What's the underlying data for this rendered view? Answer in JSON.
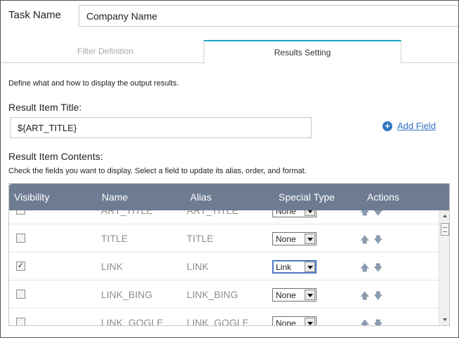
{
  "task": {
    "label": "Task Name",
    "value": "Company Name"
  },
  "tabs": [
    {
      "label": "Filter Definition",
      "active": false
    },
    {
      "label": "Results Setting",
      "active": true
    }
  ],
  "description": "Define what and how to display the output results.",
  "result_item_title": {
    "label": "Result Item Title:",
    "value": "${ART_TITLE}"
  },
  "add_field": {
    "icon": "plus-circle-icon",
    "label": "Add Field"
  },
  "result_item_contents": {
    "label": "Result Item Contents:",
    "help": "Check the fields you want to display. Select a field to update its alias, order, and format."
  },
  "grid": {
    "columns": [
      "Visibility",
      "Name",
      "Alias",
      "Special Type",
      "Actions"
    ],
    "rows": [
      {
        "checked": false,
        "name": "ART_TITLE",
        "alias": "ART_TITLE",
        "special": "None"
      },
      {
        "checked": false,
        "name": "TITLE",
        "alias": "TITLE",
        "special": "None"
      },
      {
        "checked": true,
        "name": "LINK",
        "alias": "LINK",
        "special": "Link"
      },
      {
        "checked": false,
        "name": "LINK_BING",
        "alias": "LINK_BING",
        "special": "None"
      },
      {
        "checked": false,
        "name": "LINK_GOGLE",
        "alias": "LINK_GOGLE",
        "special": "None"
      }
    ]
  },
  "colors": {
    "tab_accent": "#1ea2c9",
    "header_bg": "#6e7c92",
    "link": "#2f74c0"
  }
}
